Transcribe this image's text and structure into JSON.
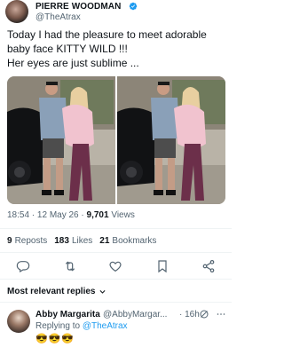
{
  "author": {
    "name": "PIERRE WOODMAN",
    "handle": "@TheAtrax",
    "verified_icon": "verified-badge-icon",
    "badge_color": "#1d9bf0"
  },
  "tweet": {
    "lines": [
      "Today I had the pleasure to meet adorable",
      "baby face KITTY WILD !!!",
      "Her eyes are just sublime ..."
    ]
  },
  "meta": {
    "time": "18:54",
    "sep": " · ",
    "date": "12 May 26",
    "views_count": "9,701",
    "views_label": " Views"
  },
  "stats": {
    "reposts_count": "9",
    "reposts_label": "Reposts",
    "likes_count": "183",
    "likes_label": "Likes",
    "bookmarks_count": "21",
    "bookmarks_label": "Bookmarks"
  },
  "actions": {
    "reply": "reply-icon",
    "repost": "repost-icon",
    "like": "heart-icon",
    "bookmark": "bookmark-icon",
    "share": "share-icon"
  },
  "replies": {
    "sort_label": "Most relevant replies",
    "items": [
      {
        "name": "Abby Margarita",
        "handle": "@AbbyMargar...",
        "time": "· 16h",
        "replying_prefix": "Replying to ",
        "replying_to": "@TheAtrax",
        "text": "😎😎😎"
      }
    ]
  },
  "colors": {
    "text": "#0f1419",
    "secondary": "#536471",
    "accent": "#1d9bf0",
    "divider": "#eff3f4"
  }
}
